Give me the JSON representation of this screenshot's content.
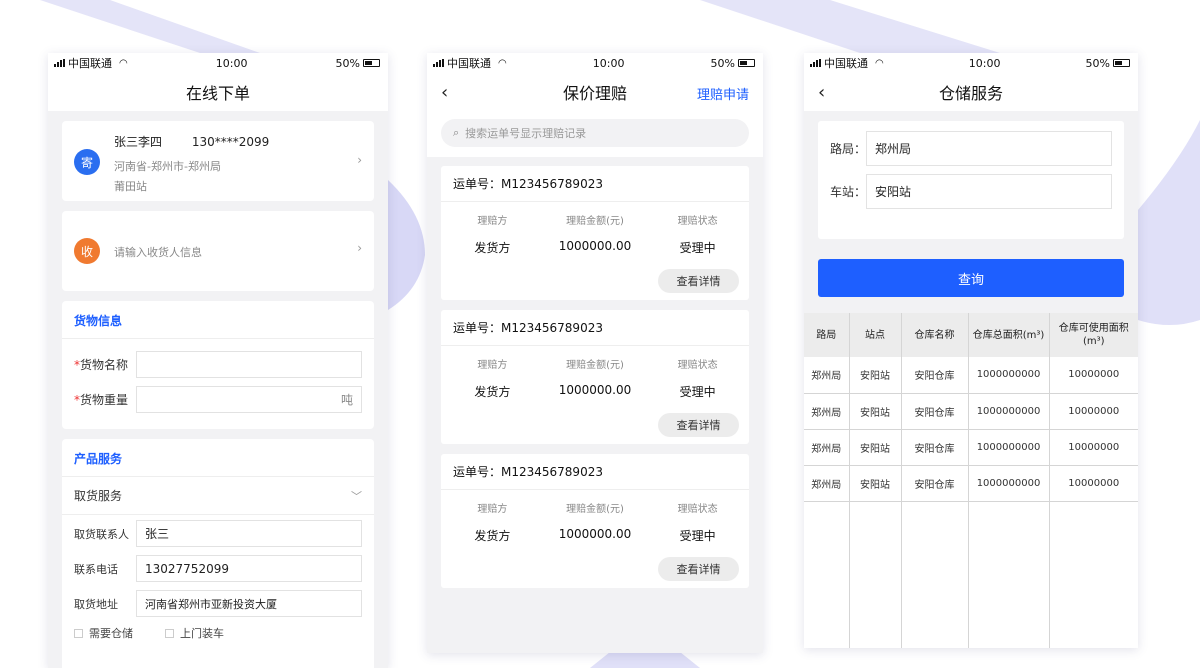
{
  "status": {
    "carrier": "中国联通",
    "time": "10:00",
    "battery": "50%"
  },
  "order": {
    "title": "在线下单",
    "sender": {
      "badge": "寄",
      "name": "张三李四",
      "phone": "130****2099",
      "address_line1": "河南省-郑州市-郑州局",
      "address_line2": "莆田站"
    },
    "receiver": {
      "badge": "收",
      "placeholder": "请输入收货人信息"
    },
    "cargo": {
      "section_title": "货物信息",
      "name_label": "货物名称",
      "weight_label": "货物重量",
      "weight_unit": "吨"
    },
    "service": {
      "section_title": "产品服务",
      "pickup_label": "取货服务",
      "contact_label": "取货联系人",
      "contact_value": "张三",
      "phone_label": "联系电话",
      "phone_value": "13027752099",
      "address_label": "取货地址",
      "address_value": "河南省郑州市亚新投资大厦",
      "option1": "需要仓储",
      "option2": "上门装车"
    }
  },
  "claims": {
    "title": "保价理赔",
    "apply": "理赔申请",
    "search_placeholder": "搜索运单号显示理赔记录",
    "col_labels": [
      "理赔方",
      "理赔金额(元)",
      "理赔状态"
    ],
    "detail_button": "查看详情",
    "items": [
      {
        "waybill": "运单号：M123456789023",
        "party": "发货方",
        "amount": "1000000.00",
        "state": "受理中"
      },
      {
        "waybill": "运单号：M123456789023",
        "party": "发货方",
        "amount": "1000000.00",
        "state": "受理中"
      },
      {
        "waybill": "运单号：M123456789023",
        "party": "发货方",
        "amount": "1000000.00",
        "state": "受理中"
      }
    ]
  },
  "warehouse": {
    "title": "仓储服务",
    "bureau_label": "路局：",
    "bureau_value": "郑州局",
    "station_label": "车站：",
    "station_value": "安阳站",
    "query_button": "查询",
    "headers": [
      "路局",
      "站点",
      "仓库名称",
      "仓库总面积(m³)",
      "仓库可使用面积(m³)"
    ],
    "rows": [
      [
        "郑州局",
        "安阳站",
        "安阳仓库",
        "1000000000",
        "10000000"
      ],
      [
        "郑州局",
        "安阳站",
        "安阳仓库",
        "1000000000",
        "10000000"
      ],
      [
        "郑州局",
        "安阳站",
        "安阳仓库",
        "1000000000",
        "10000000"
      ],
      [
        "郑州局",
        "安阳站",
        "安阳仓库",
        "1000000000",
        "10000000"
      ]
    ]
  },
  "colors": {
    "accent": "#1e5fff",
    "sender_badge": "#2a6ef0",
    "receiver_badge": "#f07a30",
    "decor": "#dcdcf6"
  }
}
